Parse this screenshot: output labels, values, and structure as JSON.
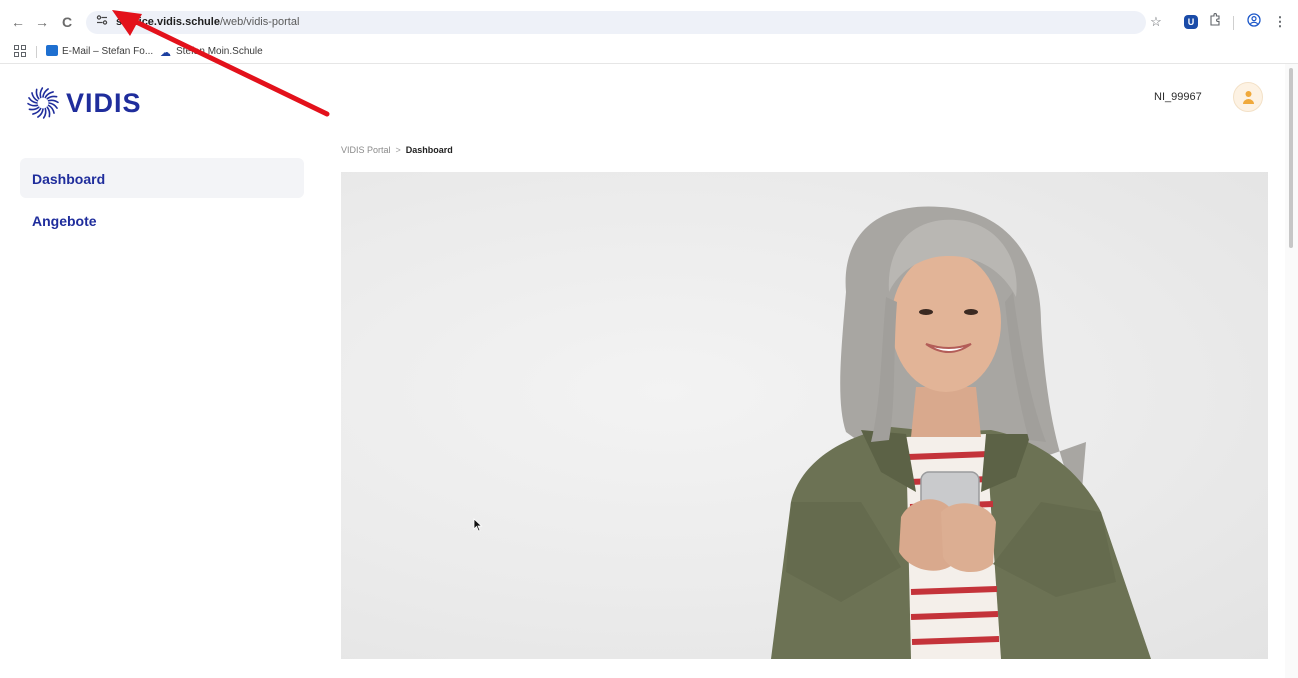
{
  "browser": {
    "back_icon": "←",
    "forward_icon": "→",
    "reload_icon": "C",
    "url_host": "service.vidis.schule",
    "url_path": "/web/vidis-portal",
    "icons": [
      "back-icon",
      "forward-icon",
      "reload-icon",
      "site-settings-icon",
      "star-icon",
      "extension-u-icon",
      "puzzle-icon",
      "profile-icon",
      "menu-icon"
    ],
    "bookmarks": [
      {
        "label": "E-Mail – Stefan Fo..."
      },
      {
        "label": "Stefan Moin.Schule"
      }
    ]
  },
  "header": {
    "logo_text": "VIDIS",
    "user_id": "NI_99967"
  },
  "sidebar": {
    "items": [
      {
        "label": "Dashboard",
        "active": true
      },
      {
        "label": "Angebote",
        "active": false
      }
    ]
  },
  "breadcrumb": {
    "root": "VIDIS Portal",
    "separator": ">",
    "current": "Dashboard"
  },
  "colors": {
    "brand": "#1f2d9c",
    "annotation_arrow": "#e3111b",
    "avatar_accent": "#f0a93b"
  }
}
